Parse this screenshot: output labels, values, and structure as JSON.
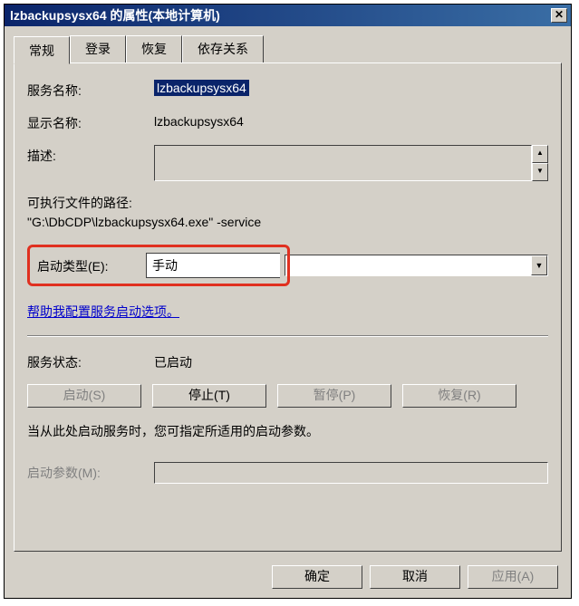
{
  "title": "lzbackupsysx64 的属性(本地计算机)",
  "tabs": [
    "常规",
    "登录",
    "恢复",
    "依存关系"
  ],
  "general": {
    "service_name_label": "服务名称:",
    "service_name": "lzbackupsysx64",
    "display_name_label": "显示名称:",
    "display_name": "lzbackupsysx64",
    "description_label": "描述:",
    "path_label": "可执行文件的路径:",
    "path_value": "\"G:\\DbCDP\\lzbackupsysx64.exe\" -service",
    "startup_type_label": "启动类型(E):",
    "startup_type_value": "手动",
    "help_link": "帮助我配置服务启动选项。",
    "status_label": "服务状态:",
    "status_value": "已启动",
    "buttons": {
      "start": "启动(S)",
      "stop": "停止(T)",
      "pause": "暂停(P)",
      "resume": "恢复(R)"
    },
    "info_text": "当从此处启动服务时，您可指定所适用的启动参数。",
    "start_params_label": "启动参数(M):"
  },
  "footer": {
    "ok": "确定",
    "cancel": "取消",
    "apply": "应用(A)"
  }
}
